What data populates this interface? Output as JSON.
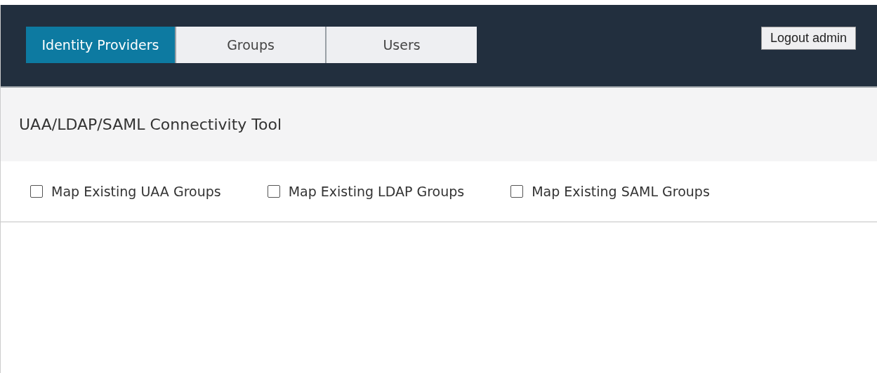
{
  "tabs": [
    {
      "label": "Identity Providers",
      "selected": true
    },
    {
      "label": "Groups",
      "selected": false
    },
    {
      "label": "Users",
      "selected": false
    }
  ],
  "logout_button": "Logout admin",
  "page_title": "UAA/LDAP/SAML Connectivity Tool",
  "options": [
    {
      "label": "Map Existing UAA Groups",
      "checked": false
    },
    {
      "label": "Map Existing LDAP Groups",
      "checked": false
    },
    {
      "label": "Map Existing SAML Groups",
      "checked": false
    }
  ]
}
